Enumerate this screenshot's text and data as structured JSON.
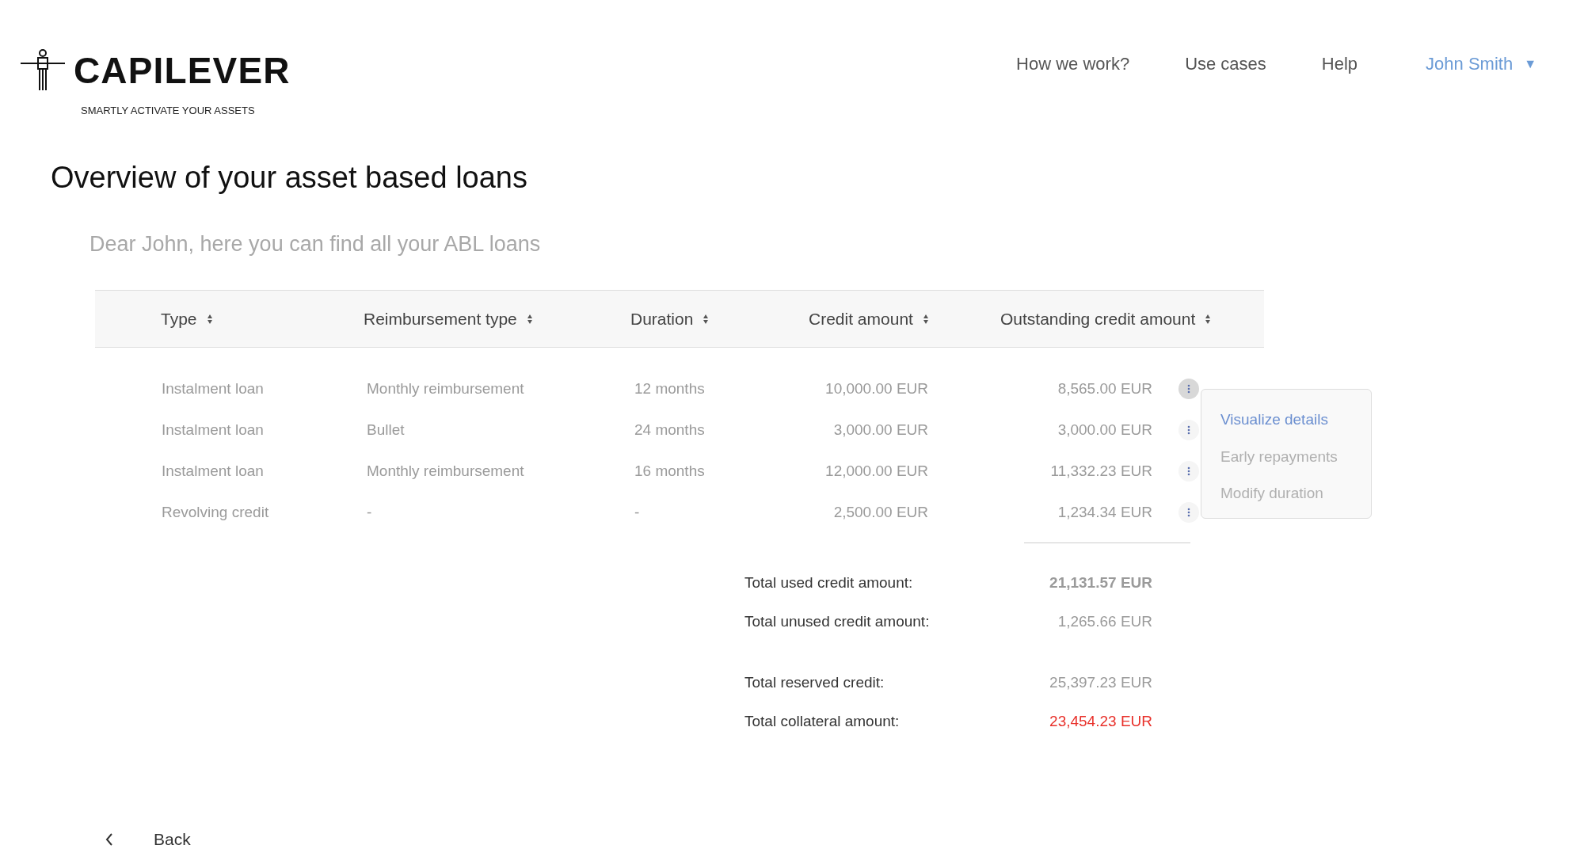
{
  "brand": {
    "name": "CAPILEVER",
    "tagline": "SMARTLY ACTIVATE YOUR ASSETS"
  },
  "nav": {
    "links": [
      "How we work?",
      "Use cases",
      "Help"
    ],
    "user": "John Smith",
    "user_caret": "▼"
  },
  "title": "Overview of your asset based loans",
  "subtitle": "Dear John, here you can find all your ABL loans",
  "table": {
    "columns": [
      "Type",
      "Reimbursement type",
      "Duration",
      "Credit amount",
      "Outstanding credit amount"
    ],
    "rows": [
      {
        "cells": [
          "Instalment loan",
          "Monthly reimbursement",
          "12 months",
          "10,000.00 EUR",
          "8,565.00 EUR"
        ],
        "menu_open": true
      },
      {
        "cells": [
          "Instalment loan",
          "Bullet",
          "24 months",
          "3,000.00 EUR",
          "3,000.00 EUR"
        ],
        "menu_open": false
      },
      {
        "cells": [
          "Instalment loan",
          "Monthly reimbursement",
          "16 months",
          "12,000.00 EUR",
          "11,332.23 EUR"
        ],
        "menu_open": false
      },
      {
        "cells": [
          "Revolving credit",
          "-",
          "-",
          "2,500.00 EUR",
          "1,234.34 EUR"
        ],
        "menu_open": false
      }
    ]
  },
  "row_menu": [
    {
      "label": "Visualize details",
      "selected": true
    },
    {
      "label": "Early repayments",
      "selected": false
    },
    {
      "label": "Modify duration",
      "selected": false
    }
  ],
  "totals": [
    {
      "label": "Total used credit amount:",
      "value": "21,131.57 EUR",
      "kind": "bold"
    },
    {
      "label": "Total unused credit amount:",
      "value": "1,265.66 EUR",
      "kind": "normal"
    },
    {
      "label": "Total reserved credit:",
      "value": "25,397.23 EUR",
      "kind": "normal"
    },
    {
      "label": "Total collateral amount:",
      "value": "23,454.23 EUR",
      "kind": "alert"
    }
  ],
  "back": "Back"
}
